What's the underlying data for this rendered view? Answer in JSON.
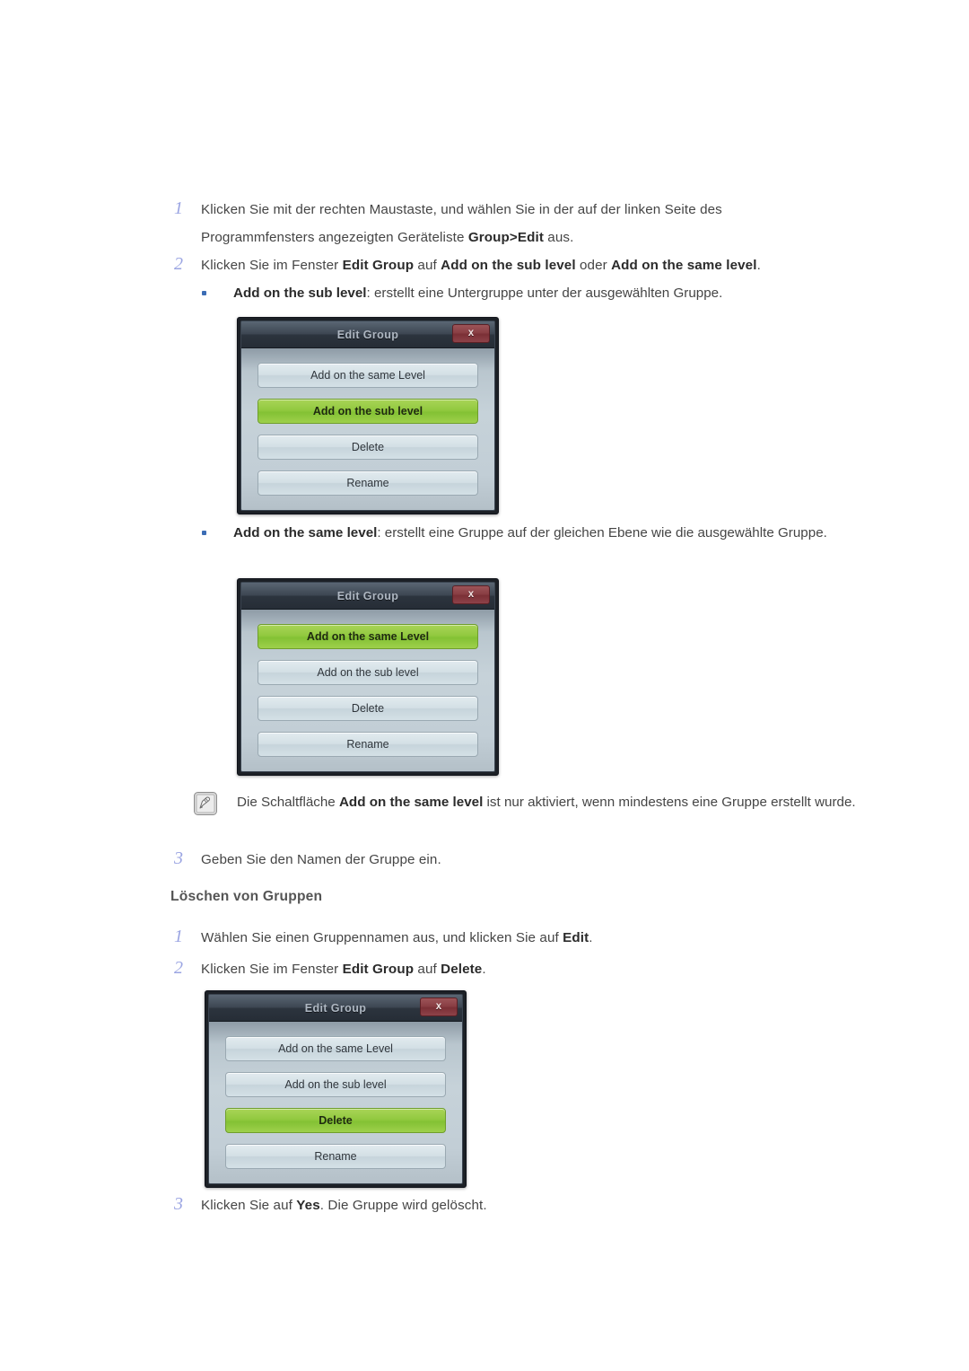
{
  "steps": [
    {
      "num": "1",
      "html": "Klicken Sie mit der rechten Maustaste, und wählen Sie in der auf der linken Seite des Programmfensters angezeigten Geräteliste <b>Group&gt;Edit</b> aus."
    },
    {
      "num": "2",
      "html": "Klicken Sie im Fenster <b>Edit Group</b> auf <b>Add on the sub level</b> oder <b>Add on the same level</b>."
    },
    {
      "num": "3",
      "html": "Geben Sie den Namen der Gruppe ein."
    },
    {
      "num": "1",
      "html": "Wählen Sie einen Gruppennamen aus, und klicken Sie auf <b>Edit</b>."
    },
    {
      "num": "2",
      "html": "Klicken Sie im Fenster <b>Edit Group</b> auf <b>Delete</b>."
    },
    {
      "num": "3",
      "html": "Klicken Sie auf <b>Yes</b>. Die Gruppe wird gelöscht."
    }
  ],
  "bullets": [
    {
      "html": "<b>Add on the sub level</b>: erstellt eine Untergruppe unter der ausgewählten Gruppe."
    },
    {
      "html": "<b>Add on the same level</b>: erstellt eine Gruppe auf der gleichen Ebene wie die ausgewählte Gruppe."
    }
  ],
  "note": {
    "icon": "note-pencil-icon",
    "html": "Die Schaltfläche <b>Add on the same level</b> ist nur aktiviert, wenn mindestens eine Gruppe erstellt wurde."
  },
  "section_heading": "Löschen von Gruppen",
  "dialogs": [
    {
      "title": "Edit Group",
      "close_label": "x",
      "buttons": [
        {
          "label": "Add on the same Level",
          "selected": false
        },
        {
          "label": "Add on the sub level",
          "selected": true
        },
        {
          "label": "Delete",
          "selected": false
        },
        {
          "label": "Rename",
          "selected": false
        }
      ]
    },
    {
      "title": "Edit Group",
      "close_label": "x",
      "buttons": [
        {
          "label": "Add on the same Level",
          "selected": true
        },
        {
          "label": "Add on the sub level",
          "selected": false
        },
        {
          "label": "Delete",
          "selected": false
        },
        {
          "label": "Rename",
          "selected": false
        }
      ]
    },
    {
      "title": "Edit Group",
      "close_label": "x",
      "buttons": [
        {
          "label": "Add on the same Level",
          "selected": false
        },
        {
          "label": "Add on the sub level",
          "selected": false
        },
        {
          "label": "Delete",
          "selected": true
        },
        {
          "label": "Rename",
          "selected": false
        }
      ]
    }
  ],
  "colors": {
    "step_number": "#9aa4e2",
    "bullet": "#3c6db5",
    "selected_button_green": "#8cc63e",
    "dialog_titlebar": "#3d4652",
    "close_button_red": "#8a3e44",
    "body_text": "#454545"
  }
}
